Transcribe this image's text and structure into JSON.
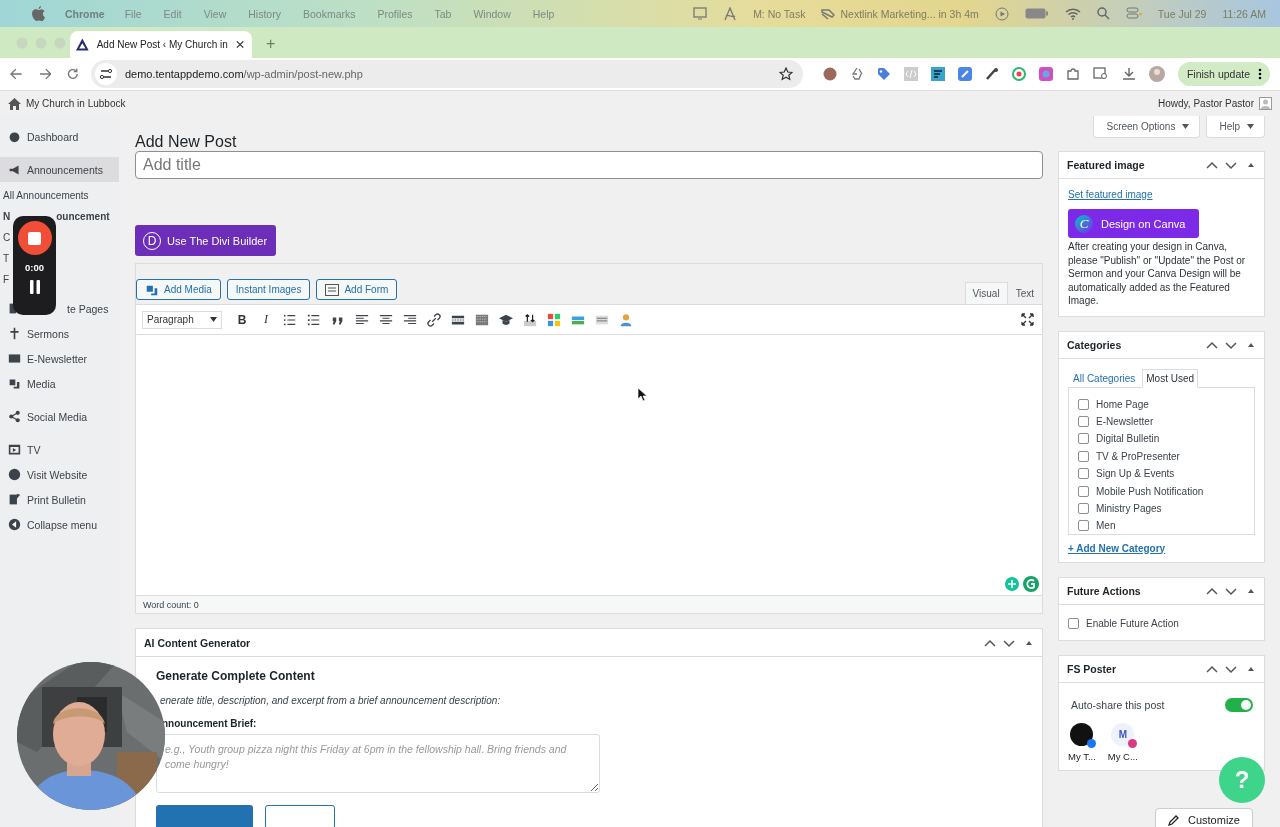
{
  "menu_bar": {
    "app": "Chrome",
    "items": [
      "File",
      "Edit",
      "View",
      "History",
      "Bookmarks",
      "Profiles",
      "Tab",
      "Window",
      "Help"
    ],
    "task": "M: No Task",
    "event": "Nextlink Marketing... in 3h 4m",
    "date": "Tue Jul 29",
    "time": "11:26 AM"
  },
  "browser": {
    "tabs": [
      {
        "title": "Add New Post ‹ My Church in",
        "selected": true
      }
    ],
    "new_tab": "+",
    "url_host": "demo.tentappdemo.com",
    "url_path": "/wp-admin/post-new.php",
    "update_button": "Finish update"
  },
  "admin_bar": {
    "site": "My Church in Lubbock",
    "greeting": "Howdy, Pastor Pastor"
  },
  "sidebar": {
    "items": [
      {
        "label": "Dashboard",
        "kind": "menu",
        "selected": false
      },
      {
        "label": "Announcements",
        "kind": "menu",
        "selected": true
      },
      {
        "label": "All Announcements",
        "kind": "sub",
        "selected": false
      },
      {
        "label": "N",
        "rest": "ouncement",
        "kind": "sub",
        "selected": true
      },
      {
        "label": "C",
        "kind": "sub",
        "selected": false
      },
      {
        "label": "T",
        "kind": "sub",
        "selected": false
      },
      {
        "label": "F",
        "kind": "sub",
        "selected": false
      },
      {
        "label": "te Pages",
        "kind": "covered",
        "selected": false
      },
      {
        "label": "Sermons",
        "kind": "menu",
        "selected": false
      },
      {
        "label": "E-Newsletter",
        "kind": "menu",
        "selected": false
      },
      {
        "label": "Media",
        "kind": "menu",
        "selected": false
      },
      {
        "label": "Social Media",
        "kind": "menu",
        "selected": false
      },
      {
        "label": "TV",
        "kind": "menu",
        "selected": false
      },
      {
        "label": "Visit Website",
        "kind": "menu",
        "selected": false
      },
      {
        "label": "Print Bulletin",
        "kind": "menu",
        "selected": false
      },
      {
        "label": "Collapse menu",
        "kind": "menu",
        "selected": false
      }
    ]
  },
  "recorder": {
    "time": "0:00"
  },
  "page": {
    "title": "Add New Post",
    "screen_options": "Screen Options",
    "help": "Help"
  },
  "title_field": {
    "placeholder": "Add title"
  },
  "divi_button": {
    "logo": "D",
    "label": "Use The Divi Builder"
  },
  "editor": {
    "media_buttons": [
      "Add Media",
      "Instant Images",
      "Add Form"
    ],
    "tabs": [
      {
        "label": "Visual",
        "selected": true
      },
      {
        "label": "Text",
        "selected": false
      }
    ],
    "format": "Paragraph",
    "bold": "B",
    "italic": "I",
    "word_count": "Word count: 0"
  },
  "ai_box": {
    "title": "AI Content Generator",
    "heading": "Generate Complete Content",
    "description": "enerate title, description, and excerpt from a brief announcement description:",
    "label": "nnouncement Brief:",
    "placeholder": "e.g., Youth group pizza night this Friday at 6pm in the fellowship hall. Bring friends and come hungry!"
  },
  "featured_image": {
    "title": "Featured image",
    "link": "Set featured image",
    "canva_logo": "C",
    "canva_button": "Design on Canva",
    "note": "After creating your design in Canva, please \"Publish\" or \"Update\" the Post or Sermon and your Canva Design will be automatically added as the Featured Image."
  },
  "categories": {
    "title": "Categories",
    "tabs": [
      {
        "label": "All Categories",
        "selected": false
      },
      {
        "label": "Most Used",
        "selected": true
      }
    ],
    "items": [
      {
        "label": "Home Page",
        "checked": false
      },
      {
        "label": "E-Newsletter",
        "checked": false
      },
      {
        "label": "Digital Bulletin",
        "checked": false
      },
      {
        "label": "TV & ProPresenter",
        "checked": false
      },
      {
        "label": "Sign Up & Events",
        "checked": false
      },
      {
        "label": "Mobile Push Notification",
        "checked": false
      },
      {
        "label": "Ministry Pages",
        "checked": false
      },
      {
        "label": "Men",
        "checked": false
      }
    ],
    "add_link": "+ Add New Category"
  },
  "future_actions": {
    "title": "Future Actions",
    "label": "Enable Future Action",
    "checked": false
  },
  "fs_poster": {
    "title": "FS Poster",
    "auto_share": "Auto-share this post",
    "on": true,
    "accounts": [
      {
        "name": "My T...",
        "kind": "facebook"
      },
      {
        "name": "My C...",
        "kind": "instagram",
        "initial": "M"
      }
    ]
  },
  "help_bubble": "?",
  "customize": "Customize"
}
